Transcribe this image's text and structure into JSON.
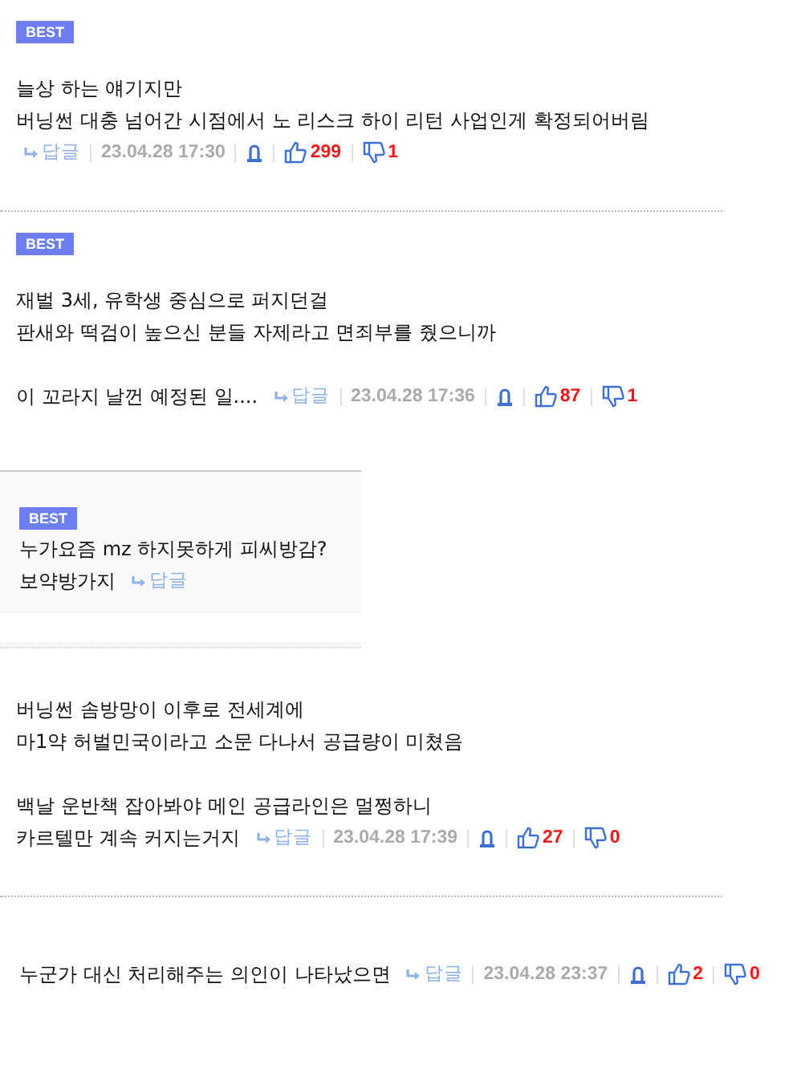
{
  "comments": [
    {
      "kind": "comment",
      "badge": "BEST",
      "paragraphs": [
        [
          "늘상 하는 얘기지만",
          "버닝썬 대충 넘어간 시점에서 노 리스크 하이 리턴 사업인게 확정되어버림"
        ]
      ],
      "meta_newline": true,
      "reply": "답글",
      "date": "23.04.28 17:30",
      "likes": "299",
      "dislikes": "1"
    },
    {
      "kind": "comment",
      "badge": "BEST",
      "paragraphs": [
        [
          "재벌 3세, 유학생 중심으로 퍼지던걸",
          "판새와 떡검이 높으신 분들 자제라고 면죄부를 줬으니까"
        ],
        [
          "이 꼬라지 날껀 예정된 일...."
        ]
      ],
      "meta_newline": false,
      "reply": "답글",
      "date": "23.04.28 17:36",
      "likes": "87",
      "dislikes": "1"
    },
    {
      "kind": "reply",
      "badge": "BEST",
      "paragraphs": [
        [
          "누가요즘 mz 하지못하게 피씨방감?",
          "보약방가지"
        ]
      ],
      "reply": "답글"
    },
    {
      "kind": "comment",
      "paragraphs": [
        [
          "버닝썬 솜방망이 이후로 전세계에",
          "마1약 허벌민국이라고 소문 다나서 공급량이 미쳤음"
        ],
        [
          "백날 운반책 잡아봐야 메인 공급라인은 멀쩡하니",
          "카르텔만 계속 커지는거지"
        ]
      ],
      "meta_newline": false,
      "reply": "답글",
      "date": "23.04.28 17:39",
      "likes": "27",
      "dislikes": "0"
    },
    {
      "kind": "comment",
      "paragraphs": [
        [
          "누군가 대신 처리해주는 의인이 나타났으면"
        ]
      ],
      "meta_newline": false,
      "reply": "답글",
      "date": "23.04.28 23:37",
      "likes": "2",
      "dislikes": "0"
    }
  ]
}
